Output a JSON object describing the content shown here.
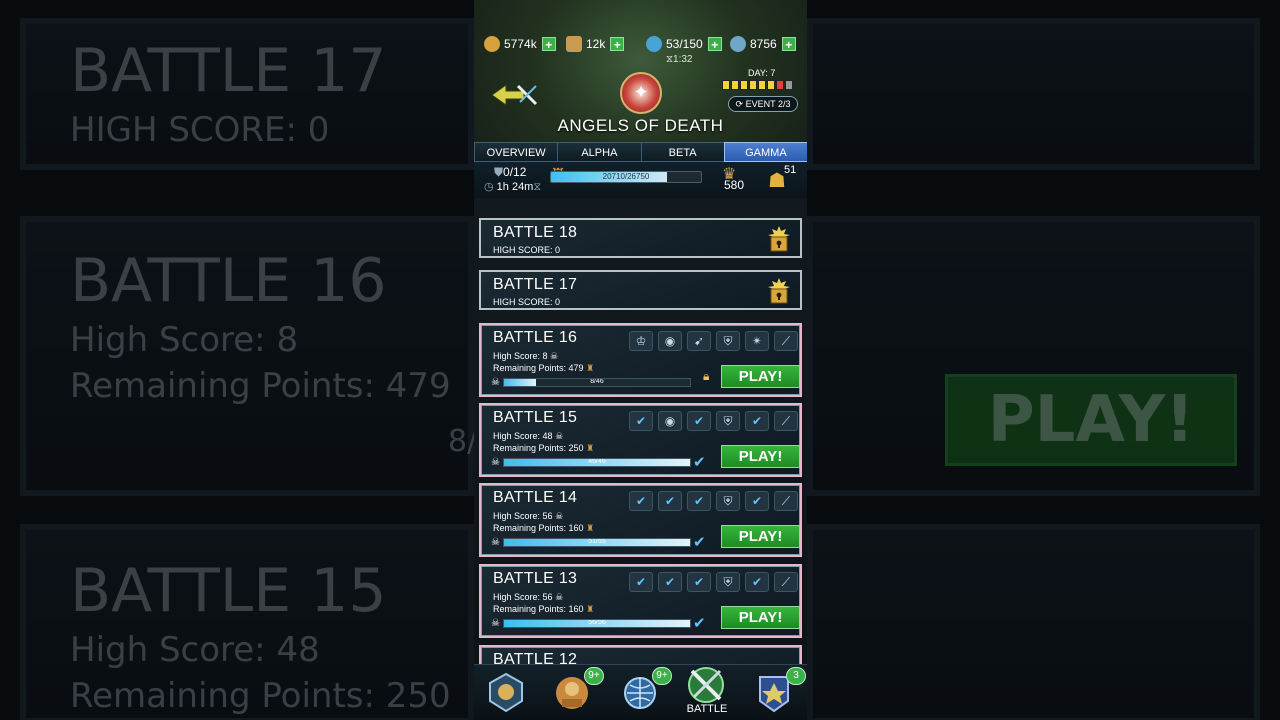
{
  "resources": [
    {
      "icon": "gold-coin-icon",
      "value": "5774k"
    },
    {
      "icon": "requisition-icon",
      "value": "12k"
    },
    {
      "icon": "energy-icon",
      "value": "53/150"
    },
    {
      "icon": "blackstone-icon",
      "value": "8756"
    }
  ],
  "header": {
    "timer": "1:32",
    "title": "ANGELS OF DEATH",
    "day_label": "DAY: 7",
    "event_label": "EVENT 2/3"
  },
  "tabs": [
    {
      "label": "OVERVIEW",
      "active": false
    },
    {
      "label": "ALPHA",
      "active": false
    },
    {
      "label": "BETA",
      "active": false
    },
    {
      "label": "GAMMA",
      "active": true
    }
  ],
  "status": {
    "attempts": "0/12",
    "time_left": "1h 24m",
    "progress_label": "20710/26750",
    "progress": 0.774,
    "trophy_value": "580",
    "team_count": "51"
  },
  "battles": [
    {
      "name": "BATTLE 18",
      "high_score": "HIGH SCORE: 0",
      "locked": true
    },
    {
      "name": "BATTLE 17",
      "high_score": "HIGH SCORE: 0",
      "locked": true
    },
    {
      "name": "BATTLE 16",
      "high_score": "High Score: 8",
      "remaining": "Remaining Points: 479",
      "progress_label": "8/46",
      "progress": 0.17,
      "play": "PLAY!",
      "done": [
        false,
        false,
        false,
        false,
        false,
        false
      ]
    },
    {
      "name": "BATTLE 15",
      "high_score": "High Score: 48",
      "remaining": "Remaining Points: 250",
      "progress_label": "46/46",
      "progress": 1.0,
      "play": "PLAY!",
      "done": [
        true,
        false,
        true,
        false,
        true,
        false
      ]
    },
    {
      "name": "BATTLE 14",
      "high_score": "High Score: 56",
      "remaining": "Remaining Points: 160",
      "progress_label": "51/55",
      "progress": 1.0,
      "play": "PLAY!",
      "done": [
        true,
        true,
        true,
        false,
        true,
        false
      ]
    },
    {
      "name": "BATTLE 13",
      "high_score": "High Score: 56",
      "remaining": "Remaining Points: 160",
      "progress_label": "56/56",
      "progress": 1.0,
      "play": "PLAY!",
      "done": [
        true,
        true,
        true,
        false,
        true,
        false
      ]
    },
    {
      "name": "BATTLE 12"
    }
  ],
  "nav": {
    "badge_1": "9+",
    "badge_2": "9+",
    "battle_label": "BATTLE",
    "badge_4": "3"
  },
  "background": {
    "b17": "BATTLE 17",
    "b17_hs": "HIGH SCORE: 0",
    "b16": "BATTLE 16",
    "b16_hs": "High Score: 8",
    "b16_rp": "Remaining Points: 479",
    "b16_prog": "8/",
    "b15": "BATTLE 15",
    "b15_hs": "High Score: 48",
    "b15_rp": "Remaining Points: 250",
    "play": "PLAY!"
  }
}
